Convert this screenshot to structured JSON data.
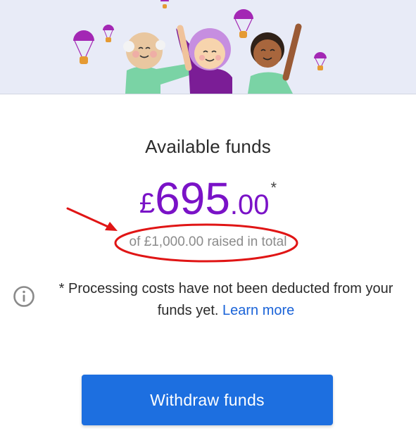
{
  "funds": {
    "title": "Available funds",
    "currency_symbol": "£",
    "amount_whole": "695",
    "amount_cents": ".00",
    "asterisk": "*",
    "raised_total": "of £1,000.00 raised in total"
  },
  "info": {
    "icon": "info-circle-icon",
    "text": "* Processing costs have not been deducted from your funds yet.",
    "learn_more": "Learn more"
  },
  "actions": {
    "withdraw_label": "Withdraw funds"
  },
  "colors": {
    "amount": "#7a12c7",
    "link": "#1a63d8",
    "button": "#1d6fe0",
    "annotation": "#e01515",
    "banner_bg": "#e8ebf7"
  }
}
